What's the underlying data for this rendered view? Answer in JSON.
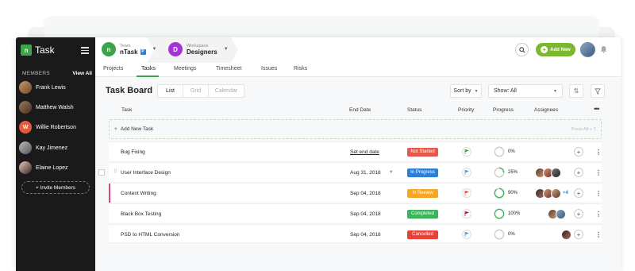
{
  "app": {
    "name": "Task"
  },
  "sidebar": {
    "members_label": "MEMBERS",
    "view_all": "View All",
    "members": [
      {
        "name": "Frank Lewis",
        "initial": "",
        "color": "#8a6a4a"
      },
      {
        "name": "Matthew Walsh",
        "initial": "",
        "color": "#6a4a3a"
      },
      {
        "name": "Willie Robertson",
        "initial": "W",
        "color": "#e65a3c"
      },
      {
        "name": "Kay Jimenez",
        "initial": "",
        "color": "#7a7a7a"
      },
      {
        "name": "Elaine Lopez",
        "initial": "",
        "color": "#3a2a2a"
      }
    ],
    "invite_label": "+ Invite Members"
  },
  "header": {
    "team": {
      "label": "Team",
      "name": "nTask",
      "initial": "n",
      "badge": "P",
      "color": "#3aa54a"
    },
    "workspace": {
      "label": "Workspace",
      "name": "Designers",
      "initial": "D",
      "color": "#a534d6"
    },
    "add_new": "Add New"
  },
  "tabs": [
    "Projects",
    "Tasks",
    "Meetings",
    "Timesheet",
    "Issues",
    "Risks"
  ],
  "board": {
    "title": "Task Board",
    "views": [
      "List",
      "Grid",
      "Calendar"
    ],
    "sort_label": "Sort by",
    "show_label": "Show: All",
    "columns": {
      "task": "Task",
      "end_date": "End Date",
      "status": "Status",
      "priority": "Priority",
      "progress": "Progress",
      "assignees": "Assignees"
    },
    "add_task": "Add New Task",
    "add_hint": "Press Alt + T"
  },
  "tasks": [
    {
      "name": "Bug Fixing",
      "date": "Set end date",
      "status": "Not Started",
      "status_color": "#e5584a",
      "priority_color": "#3aa54a",
      "progress": "0%",
      "progress_value": 0,
      "assignees": 0
    },
    {
      "name": "User Interface Design",
      "date": "Aug 31, 2018",
      "status": "In Progress",
      "status_color": "#2c7fd6",
      "priority_color": "#5aa0e0",
      "progress": "25%",
      "progress_value": 25,
      "assignees": 3
    },
    {
      "name": "Content Writing",
      "date": "Sep 04, 2018",
      "status": "In Review",
      "status_color": "#f5a623",
      "priority_color": "#e5584a",
      "progress": "90%",
      "progress_value": 90,
      "assignees": 3,
      "extra": "+4"
    },
    {
      "name": "Black Box Testing",
      "date": "Sep 04, 2018",
      "status": "Completed",
      "status_color": "#3ab55a",
      "priority_color": "#b21f3a",
      "progress": "100%",
      "progress_value": 100,
      "assignees": 2
    },
    {
      "name": "PSD to HTML Conversion",
      "date": "Sep 04, 2018",
      "status": "Cancelled",
      "status_color": "#e5423a",
      "priority_color": "#5aa0e0",
      "progress": "0%",
      "progress_value": 0,
      "assignees": 1
    }
  ]
}
